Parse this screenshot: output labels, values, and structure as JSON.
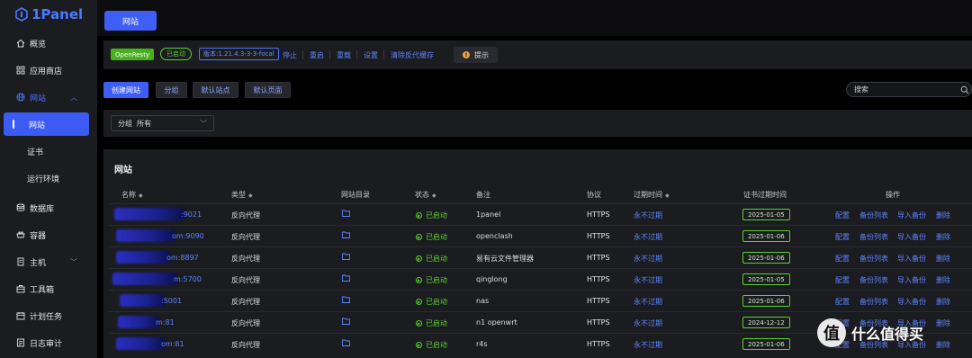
{
  "app": {
    "logo_text": "1Panel"
  },
  "sidebar": {
    "items": [
      {
        "label": "概览",
        "icon": "home-icon"
      },
      {
        "label": "应用商店",
        "icon": "grid-icon"
      },
      {
        "label": "网站",
        "icon": "globe-icon",
        "expanded": true
      },
      {
        "label": "网站",
        "sub": true,
        "active": true
      },
      {
        "label": "证书",
        "sub": true
      },
      {
        "label": "运行环境",
        "sub": true
      },
      {
        "label": "数据库",
        "icon": "database-icon"
      },
      {
        "label": "容器",
        "icon": "container-icon"
      },
      {
        "label": "主机",
        "icon": "host-icon",
        "expandable": true
      },
      {
        "label": "工具箱",
        "icon": "toolbox-icon"
      },
      {
        "label": "计划任务",
        "icon": "calendar-icon"
      },
      {
        "label": "日志审计",
        "icon": "log-icon"
      }
    ]
  },
  "topbar": {
    "tab_label": "网站"
  },
  "openresty": {
    "app_badge": "OpenResty",
    "status_badge": "已启动",
    "version_badge": "版本:1.21.4.3-3-3-focal",
    "actions": [
      "停止",
      "重启",
      "重载",
      "设置",
      "清除反代缓存"
    ],
    "tip_label": "提示",
    "colors": {
      "app_badge": "#47b11c",
      "running": "#5bd12e",
      "link": "#5c84ff"
    }
  },
  "toolbar": {
    "create_label": "创建网站",
    "group_label": "分组",
    "default_site_label": "默认站点",
    "default_page_label": "默认页面",
    "search_placeholder": "搜索"
  },
  "filter": {
    "group_prefix": "分组",
    "group_value": "所有"
  },
  "table": {
    "title": "网站",
    "columns": [
      "名称",
      "类型",
      "网站目录",
      "状态",
      "备注",
      "协议",
      "过期时间",
      "证书过期时间",
      "操作"
    ],
    "ops": [
      "配置",
      "备份列表",
      "导入备份",
      "删除"
    ],
    "rows": [
      {
        "name": ":9021",
        "type": "反向代理",
        "status": "已启动",
        "remark": "1panel",
        "protocol": "HTTPS",
        "expire": "永不过期",
        "cert_expire": "2025-01-05"
      },
      {
        "name": "om:9090",
        "type": "反向代理",
        "status": "已启动",
        "remark": "openclash",
        "protocol": "HTTPS",
        "expire": "永不过期",
        "cert_expire": "2025-01-06"
      },
      {
        "name": "om:8897",
        "type": "反向代理",
        "status": "已启动",
        "remark": "易有云文件管理器",
        "protocol": "HTTPS",
        "expire": "永不过期",
        "cert_expire": "2025-01-06"
      },
      {
        "name": "m:5700",
        "type": "反向代理",
        "status": "已启动",
        "remark": "qinglong",
        "protocol": "HTTPS",
        "expire": "永不过期",
        "cert_expire": "2025-01-05"
      },
      {
        "name": ":5001",
        "type": "反向代理",
        "status": "已启动",
        "remark": "nas",
        "protocol": "HTTPS",
        "expire": "永不过期",
        "cert_expire": "2025-01-06"
      },
      {
        "name": "m:81",
        "type": "反向代理",
        "status": "已启动",
        "remark": "n1 openwrt",
        "protocol": "HTTPS",
        "expire": "永不过期",
        "cert_expire": "2024-12-12"
      },
      {
        "name": "om:81",
        "type": "反向代理",
        "status": "已启动",
        "remark": "r4s",
        "protocol": "HTTPS",
        "expire": "永不过期",
        "cert_expire": "2025-01-06"
      }
    ]
  },
  "watermark": {
    "text": "什么值得买",
    "icon_glyph": "值"
  }
}
